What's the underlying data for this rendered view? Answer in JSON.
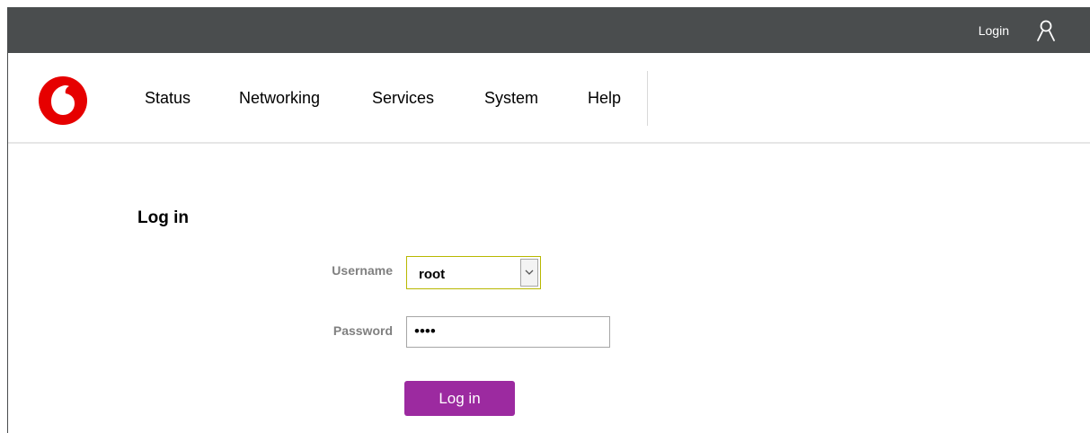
{
  "topbar": {
    "login_label": "Login",
    "user_icon": "user-icon"
  },
  "nav": {
    "logo_icon": "vodafone-logo-icon",
    "items": [
      {
        "label": "Status"
      },
      {
        "label": "Networking"
      },
      {
        "label": "Services"
      },
      {
        "label": "System"
      },
      {
        "label": "Help"
      }
    ]
  },
  "login": {
    "title": "Log in",
    "username_label": "Username",
    "username_value": "root",
    "password_label": "Password",
    "password_value": "••••",
    "submit_label": "Log in"
  },
  "colors": {
    "topbar_bg": "#4a4d4e",
    "brand_red": "#e60000",
    "button_purple": "#9c2aa0",
    "label_gray": "#808080"
  }
}
